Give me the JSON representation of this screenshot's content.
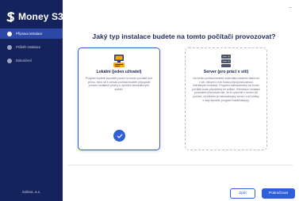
{
  "app": {
    "name": "Money S3",
    "company": "Solitea, a.s."
  },
  "sidebar": {
    "steps": [
      {
        "label": "Příprava instalace",
        "active": true
      },
      {
        "label": "Průběh instalace",
        "active": false
      },
      {
        "label": "Dokončení",
        "active": false
      }
    ]
  },
  "window": {
    "close_glyph": "–"
  },
  "main": {
    "title": "Jaký typ instalace budete na tomto počítači provozovat?",
    "options": [
      {
        "title": "Lokální (jeden uživatel)",
        "description": "Program budete spouštět pouze na tomto počítači buď přímo, nebo se k tomuto počítači budete připojovat pomocí vzdálené plochy s využitím terminálových služeb.",
        "selected": true,
        "icon": "workstation-icon"
      },
      {
        "title": "Server (pro práci v síti)",
        "description": "Na tomto počítači budete uklát data ostatním stanicím v síti, kterým k nim budou připojovat pomocí klientských instalací. Program nainstalovaný na tomto počítači bude připravený ke sdílení. Klientskou instalaci provedete jednoduše tak, že si vytvoříte v místní síti počítač, na kterém je nainstalovaný server a ze složky s daty spustíte program instalDatacpy.",
        "selected": false,
        "icon": "server-icon"
      }
    ]
  },
  "footer": {
    "back_label": "Zpět",
    "next_label": "Pokračovat"
  },
  "colors": {
    "sidebar": "#15235c",
    "accent": "#2f5fd8",
    "active_step": "#2c47a6"
  }
}
